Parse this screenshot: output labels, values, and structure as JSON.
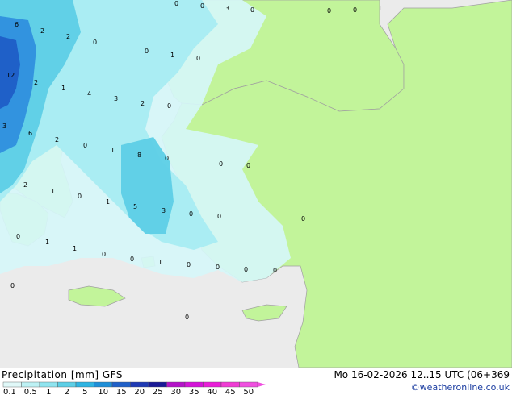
{
  "footer": {
    "title": "Precipitation [mm] GFS",
    "datetime": "Mo 16-02-2026 12..15 UTC (06+369",
    "copyright": "©weatheronline.co.uk"
  },
  "legend": {
    "labels": [
      "0.1",
      "0.5",
      "1",
      "2",
      "5",
      "10",
      "15",
      "20",
      "25",
      "30",
      "35",
      "40",
      "45",
      "50"
    ],
    "colors": [
      "#e0f8f8",
      "#bdf1f4",
      "#8fe4ef",
      "#5dcfe6",
      "#2fb4e2",
      "#1f8fd8",
      "#2060c8",
      "#1f3ab4",
      "#1a1a96",
      "#b414c8",
      "#d414d8",
      "#e91ed8",
      "#f03cd4",
      "#f050e0"
    ]
  },
  "colors": {
    "sea": "#ebebeb",
    "land": "#c2f49a",
    "precip_light": "#d6f6f8",
    "precip_mid": "#a8ecf2",
    "precip_heavy": "#5dcfe6",
    "precip_strong": "#2f8fde",
    "precip_max": "#1f60c8"
  },
  "map_labels": [
    {
      "text": "0"
    },
    {
      "text": "0"
    },
    {
      "text": "3"
    },
    {
      "text": "0"
    },
    {
      "text": "0"
    },
    {
      "text": "0"
    },
    {
      "text": "1"
    },
    {
      "text": "6"
    },
    {
      "text": "2"
    },
    {
      "text": "2"
    },
    {
      "text": "0"
    },
    {
      "text": "0"
    },
    {
      "text": "1"
    },
    {
      "text": "0"
    },
    {
      "text": "12"
    },
    {
      "text": "2"
    },
    {
      "text": "1"
    },
    {
      "text": "4"
    },
    {
      "text": "3"
    },
    {
      "text": "2"
    },
    {
      "text": "0"
    },
    {
      "text": "3"
    },
    {
      "text": "6"
    },
    {
      "text": "2"
    },
    {
      "text": "0"
    },
    {
      "text": "1"
    },
    {
      "text": "8"
    },
    {
      "text": "0"
    },
    {
      "text": "0"
    },
    {
      "text": "0"
    },
    {
      "text": "2"
    },
    {
      "text": "1"
    },
    {
      "text": "0"
    },
    {
      "text": "1"
    },
    {
      "text": "5"
    },
    {
      "text": "3"
    },
    {
      "text": "0"
    },
    {
      "text": "0"
    },
    {
      "text": "0"
    },
    {
      "text": "0"
    },
    {
      "text": "1"
    },
    {
      "text": "1"
    },
    {
      "text": "0"
    },
    {
      "text": "0"
    },
    {
      "text": "1"
    },
    {
      "text": "0"
    },
    {
      "text": "0"
    },
    {
      "text": "0"
    },
    {
      "text": "0"
    },
    {
      "text": "0"
    },
    {
      "text": "0"
    }
  ]
}
